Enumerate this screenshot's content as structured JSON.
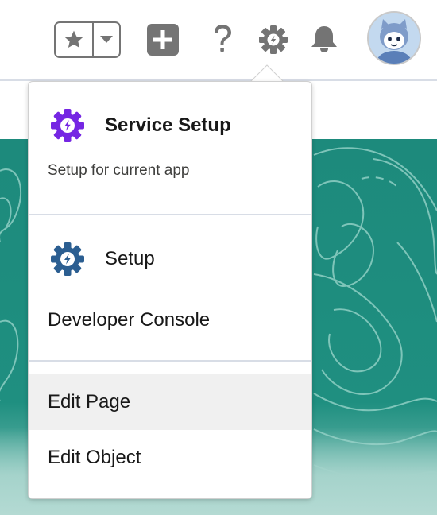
{
  "header": {
    "favorites_icon": "star-icon",
    "favorites_menu_icon": "chevron-down-icon",
    "global_actions_icon": "plus-icon",
    "help_icon": "question-icon",
    "setup_icon": "gear-icon",
    "notifications_icon": "bell-icon",
    "avatar_icon": "user-avatar"
  },
  "setup_menu": {
    "service_setup": {
      "title": "Service Setup",
      "subtitle": "Setup for current app",
      "icon": "gear-bolt-icon",
      "icon_color": "#7526e3"
    },
    "setup": {
      "label": "Setup",
      "icon": "gear-bolt-icon",
      "icon_color": "#2b5e91"
    },
    "developer_console": {
      "label": "Developer Console"
    },
    "edit_page": {
      "label": "Edit Page",
      "highlighted": true
    },
    "edit_object": {
      "label": "Edit Object"
    }
  },
  "colors": {
    "header_icon": "#747474",
    "banner": "#1d8a7c",
    "highlight": "#f0f0f0"
  }
}
